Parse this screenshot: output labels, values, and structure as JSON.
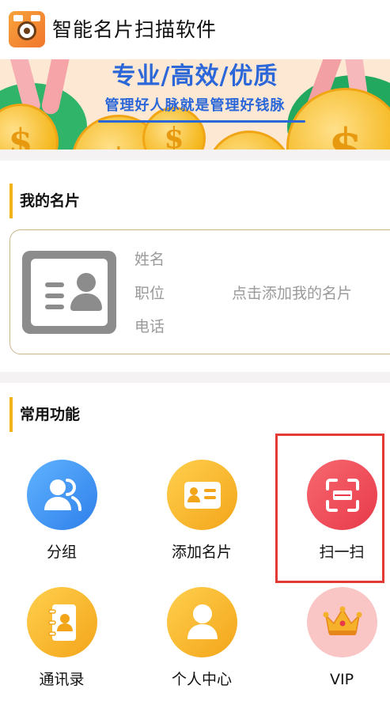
{
  "header": {
    "title": "智能名片扫描软件",
    "icon": "camera-logo-icon"
  },
  "banner": {
    "slogan": "专业/高效/优质",
    "subtitle": "管理好人脉就是管理好钱脉"
  },
  "my_card": {
    "section_title": "我的名片",
    "fields": [
      "姓名",
      "职位",
      "电话"
    ],
    "hint": "点击添加我的名片",
    "icon": "contact-card-icon"
  },
  "features": {
    "section_title": "常用功能",
    "items": [
      {
        "label": "分组",
        "icon": "group-users-icon",
        "color": "#3a8ef0"
      },
      {
        "label": "添加名片",
        "icon": "add-card-icon",
        "color": "#f5b12a"
      },
      {
        "label": "扫一扫",
        "icon": "scan-icon",
        "color": "#ee4b55"
      },
      {
        "label": "通讯录",
        "icon": "address-book-icon",
        "color": "#f5b12a"
      },
      {
        "label": "个人中心",
        "icon": "profile-icon",
        "color": "#f5b12a"
      },
      {
        "label": "VIP",
        "icon": "crown-icon",
        "color": "#f9c5c5"
      }
    ]
  },
  "colors": {
    "accent": "#f2b31a",
    "highlight_border": "#e53935",
    "brand_blue": "#2b67d8"
  }
}
